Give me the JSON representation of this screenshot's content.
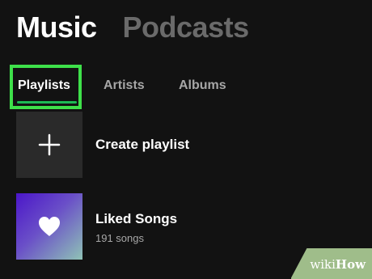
{
  "header": {
    "tabs": [
      {
        "label": "Music",
        "active": true
      },
      {
        "label": "Podcasts",
        "active": false
      }
    ]
  },
  "filters": {
    "tabs": [
      {
        "label": "Playlists",
        "active": true
      },
      {
        "label": "Artists",
        "active": false
      },
      {
        "label": "Albums",
        "active": false
      }
    ],
    "highlight_color": "#3ee04a",
    "underline_color": "#1db954"
  },
  "library": {
    "items": [
      {
        "title": "Create playlist",
        "icon": "plus-icon"
      },
      {
        "title": "Liked Songs",
        "subtitle": "191 songs",
        "icon": "heart-icon"
      }
    ]
  },
  "watermark": {
    "prefix": "wiki",
    "suffix": "How"
  }
}
